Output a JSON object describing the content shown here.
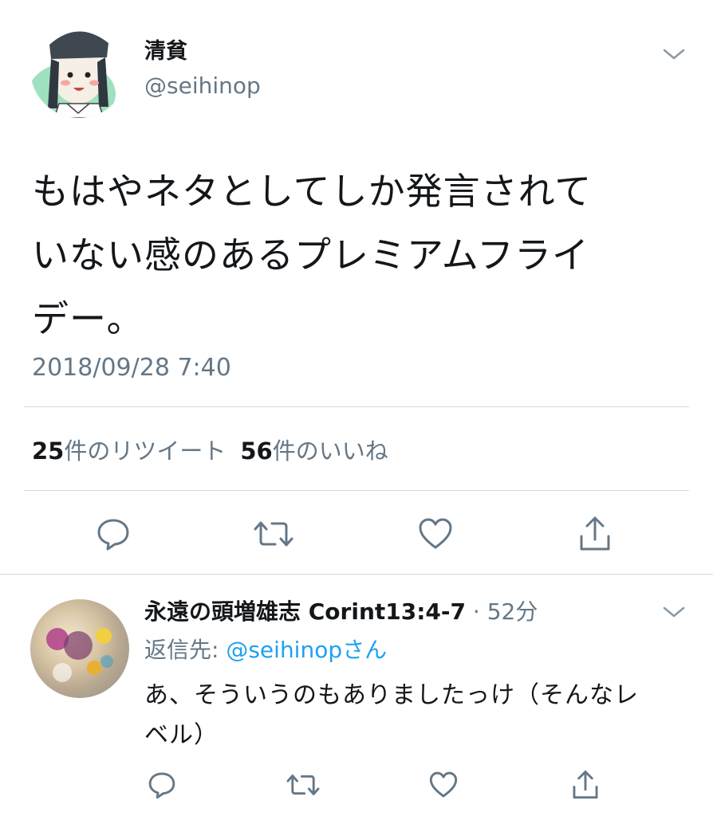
{
  "tweet": {
    "author_name": "清貧",
    "author_handle": "@seihinop",
    "text": "もはやネタとしてしか発言されて\nいない感のあるプレミアムフライ\nデー。",
    "timestamp": "2018/09/28 7:40",
    "retweet_count": "25",
    "retweet_label": "件のリツイート",
    "like_count": "56",
    "like_label": "件のいいね"
  },
  "reply": {
    "author_name": "永遠の頭増雄志 Corint13:4-7",
    "meta": "· 52分",
    "reply_to_label": "返信先: ",
    "reply_to_handle": "@seihinop",
    "reply_to_suffix": "さん",
    "text": "あ、そういうのもありましたっけ（そんなレ\nベル）"
  },
  "icons": {
    "reply": "speech-bubble-icon",
    "retweet": "retweet-icon",
    "like": "heart-icon",
    "share": "share-icon",
    "menu": "chevron-down-icon"
  },
  "colors": {
    "text": "#14171a",
    "secondary": "#657786",
    "link": "#1da1f2",
    "divider": "#d4d9de"
  }
}
